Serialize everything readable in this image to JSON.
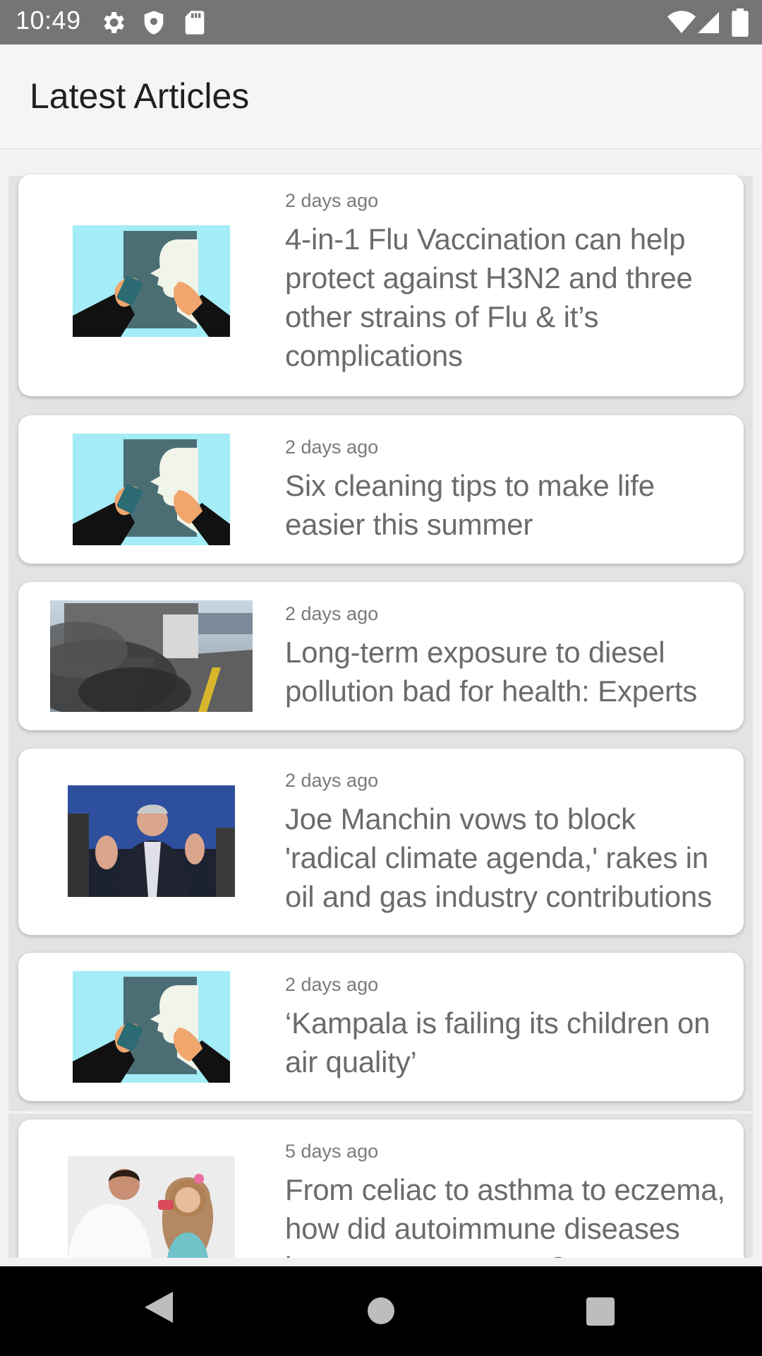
{
  "status_bar": {
    "time": "10:49",
    "icons_left": [
      "gear-icon",
      "shield-icon",
      "sd-card-icon"
    ],
    "icons_right": [
      "wifi-icon",
      "signal-icon",
      "battery-icon"
    ]
  },
  "app_bar": {
    "title": "Latest Articles"
  },
  "articles": [
    {
      "time": "2 days ago",
      "title": "4-in-1 Flu Vaccination can help protect against H3N2 and three other strains of Flu & it’s complications",
      "thumbnail": "inhaler-illustration"
    },
    {
      "time": "2 days ago",
      "title": "Six cleaning tips to make life easier this summer",
      "thumbnail": "inhaler-illustration"
    },
    {
      "time": "2 days ago",
      "title": "Long-term exposure to diesel pollution bad for health: Experts",
      "thumbnail": "diesel-exhaust-photo"
    },
    {
      "time": "2 days ago",
      "title": "Joe Manchin vows to block 'radical climate agenda,' rakes in oil and gas industry contributions",
      "thumbnail": "politician-press-photo"
    },
    {
      "time": "2 days ago",
      "title": "‘Kampala is failing its children on air quality’",
      "thumbnail": "inhaler-illustration"
    },
    {
      "time": "5 days ago",
      "title": "From celiac to asthma to eczema, how did autoimmune diseases become so common?",
      "thumbnail": "doctor-child-inhaler-photo"
    }
  ],
  "colors": {
    "status_bar": "#757575",
    "app_bar": "#f5f5f5",
    "card": "#ffffff",
    "headline": "#6b6b6b",
    "illustration_bg": "#a4ecf7"
  },
  "nav_bar": {
    "icons": [
      "back-icon",
      "home-icon",
      "recents-icon"
    ]
  }
}
